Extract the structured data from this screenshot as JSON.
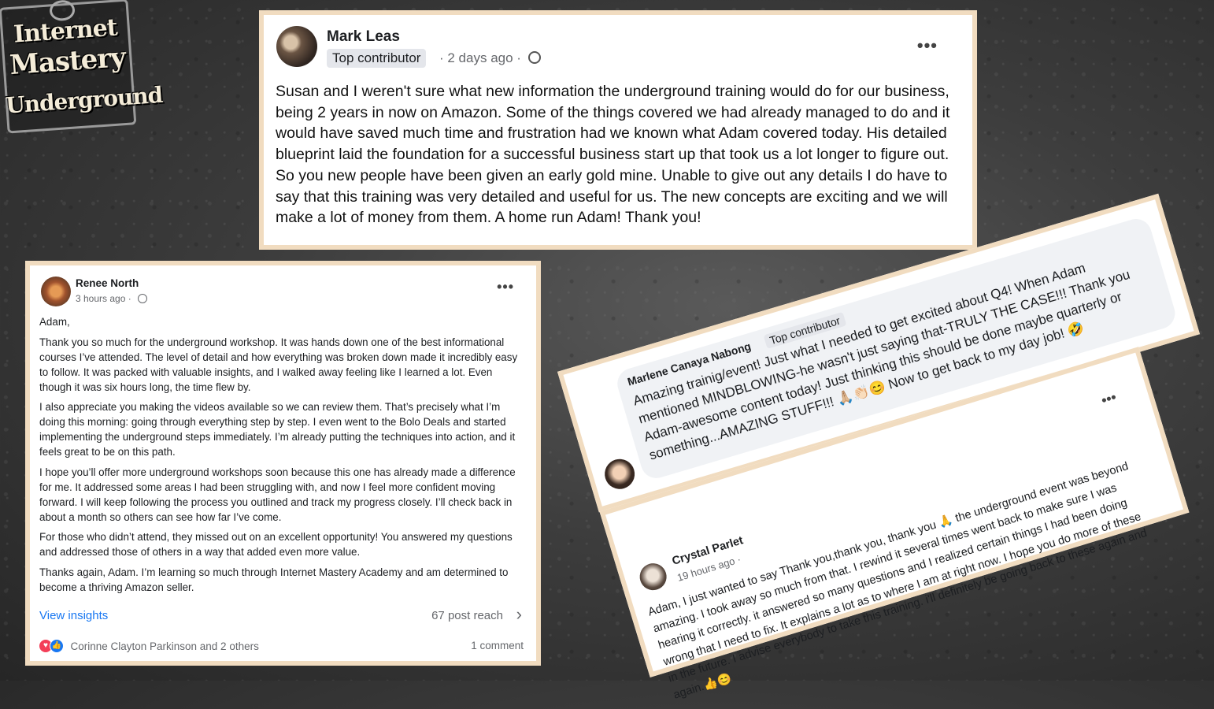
{
  "logo": {
    "line1": "Internet",
    "line2": "Mastery",
    "line3": "Underground"
  },
  "post_mark": {
    "author": "Mark Leas",
    "badge": "Top contributor",
    "time": "· 2 days ago ·",
    "more_icon": "more-horizontal-icon",
    "globe_icon": "globe-icon",
    "text": "Susan and I weren't sure what new information the underground training would do for our business, being 2 years in now on Amazon. Some of the things covered we had already managed to do and it would have saved much time and frustration had we known what Adam covered today. His detailed blueprint laid the foundation for a successful business start up that took us a lot longer to figure out. So you new people have been given an early gold mine. Unable to give out any details I do have to say that this training was very detailed and useful for us. The new concepts are exciting and we will make a lot of money from them. A home run Adam! Thank you!"
  },
  "post_renee": {
    "author": "Renee North",
    "time": "3 hours ago ·",
    "paragraphs": [
      "Adam,",
      "Thank you so much for the underground workshop. It was hands down one of the best informational courses I’ve attended. The level of detail and how everything was broken down made it incredibly easy to follow. It was packed with valuable insights, and I walked away feeling like I learned a lot. Even though it was six hours long, the time flew by.",
      "I also appreciate you making the videos available so we can review them. That’s precisely what I’m doing this morning: going through everything step by step. I even went to the Bolo Deals and started implementing the underground steps immediately. I’m already putting the techniques into action, and it feels great to be on this path.",
      "I hope you’ll offer more underground workshops soon because this one has already made a difference for me. It addressed some areas I had been struggling with, and now I feel more confident moving forward. I will keep following the process you outlined and track my progress closely. I’ll check back in about a month so others can see how far I’ve come.",
      "For those who didn’t attend, they missed out on an excellent opportunity! You answered my questions and addressed those of others in a way that added even more value.",
      "Thanks again, Adam. I’m learning so much through Internet Mastery Academy and am determined to become a thriving Amazon seller."
    ],
    "view_insights": "View insights",
    "post_reach": "67 post reach",
    "reactions_text": "Corinne Clayton Parkinson and 2 others",
    "comments": "1 comment"
  },
  "comment_marlene": {
    "author": "Marlene Canaya Nabong",
    "badge": "Top contributor",
    "text": "Amazing trainig/event! Just what I needed to get excited about Q4! When Adam mentioned MINDBLOWING-he wasn't just saying that-TRULY THE CASE!!! Thank you Adam-awesome content today! Just thinking this should be done maybe quarterly or something...AMAZING STUFF!!! 🙏🏼👏🏻😊 Now to get back to my day job! 🤣"
  },
  "comment_crystal": {
    "author": "Crystal Parlet",
    "time": "19 hours ago ·",
    "text": "Adam, I just wanted to say Thank you,thank you, thank you 🙏 the underground event was beyond amazing. I took away so much from that. I rewind it several times went back to make sure I was hearing it correctly. it answered so many questions and I realized certain things I had been doing wrong that I need to fix. It explains a lot as to where I am at right now. I hope you do more of these in the future. I advise everybody to take this training. i'll definitely be going back to these again and again.👍😊"
  },
  "colors": {
    "card_border": "#f1dcc0",
    "link_blue": "#1877f2",
    "meta_gray": "#65676b"
  }
}
